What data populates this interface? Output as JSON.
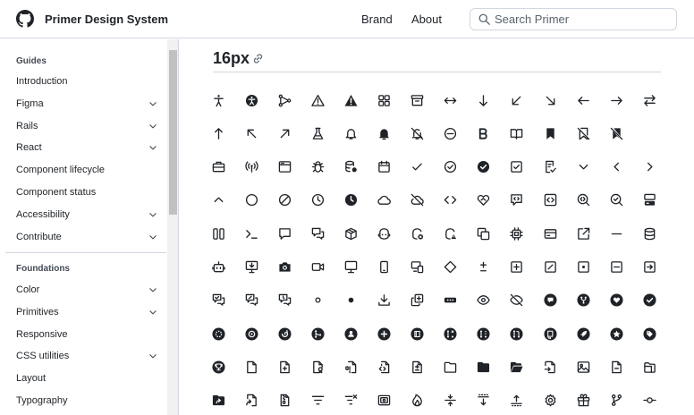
{
  "header": {
    "title": "Primer Design System",
    "nav": {
      "brand": "Brand",
      "about": "About"
    },
    "search_placeholder": "Search Primer"
  },
  "sidebar": {
    "guides_heading": "Guides",
    "guides": [
      {
        "label": "Introduction",
        "expandable": false
      },
      {
        "label": "Figma",
        "expandable": true
      },
      {
        "label": "Rails",
        "expandable": true
      },
      {
        "label": "React",
        "expandable": true
      },
      {
        "label": "Component lifecycle",
        "expandable": false
      },
      {
        "label": "Component status",
        "expandable": false
      },
      {
        "label": "Accessibility",
        "expandable": true
      },
      {
        "label": "Contribute",
        "expandable": true
      }
    ],
    "foundations_heading": "Foundations",
    "foundations": [
      {
        "label": "Color",
        "expandable": true
      },
      {
        "label": "Primitives",
        "expandable": true
      },
      {
        "label": "Responsive",
        "expandable": false
      },
      {
        "label": "CSS utilities",
        "expandable": true
      },
      {
        "label": "Layout",
        "expandable": false
      },
      {
        "label": "Typography",
        "expandable": false
      }
    ]
  },
  "main": {
    "section_title": "16px",
    "icon_rows": [
      [
        "accessibility",
        "accessibility-inset",
        "ai-model",
        "alert",
        "alert-fill",
        "apps",
        "archive",
        "arrow-both",
        "arrow-down",
        "arrow-down-left",
        "arrow-down-right",
        "arrow-left",
        "arrow-right",
        "arrow-switch"
      ],
      [
        "arrow-up",
        "arrow-up-left",
        "arrow-up-right",
        "beaker",
        "bell",
        "bell-fill",
        "bell-slash",
        "blocked",
        "bold",
        "book",
        "bookmark-fill",
        "bookmark-slash",
        "bookmark-slash-fill"
      ],
      [
        "briefcase",
        "broadcast",
        "browser",
        "bug",
        "cache",
        "calendar",
        "check",
        "check-circle",
        "check-circle-fill",
        "checkbox",
        "checklist",
        "chevron-down",
        "chevron-left",
        "chevron-right"
      ],
      [
        "chevron-up",
        "circle",
        "circle-slash",
        "clock",
        "clock-fill",
        "cloud",
        "cloud-offline",
        "code",
        "code-of-conduct",
        "code-review",
        "code-square",
        "codescan",
        "codescan-checkmark",
        "codespaces"
      ],
      [
        "columns",
        "command-palette",
        "comment",
        "comment-discussion",
        "container",
        "copilot",
        "copilot-error",
        "copilot-warning",
        "copy",
        "cpu",
        "credit-card",
        "cross-reference",
        "dash",
        "database"
      ],
      [
        "dependabot",
        "desktop-download",
        "device-camera",
        "device-camera-video",
        "device-desktop",
        "device-mobile",
        "devices",
        "diamond",
        "diff",
        "diff-added",
        "diff-ignored",
        "diff-modified",
        "diff-removed",
        "diff-renamed"
      ],
      [
        "discussion-closed",
        "discussion-duplicate",
        "discussion-outdated",
        "dot",
        "dot-fill",
        "download",
        "duplicate",
        "ellipsis",
        "eye",
        "eye-closed",
        "feed-discussion",
        "feed-forked",
        "feed-heart",
        "feed-issue-closed"
      ],
      [
        "feed-issue-draft",
        "feed-issue-open",
        "feed-issue-reopen",
        "feed-merged",
        "feed-person",
        "feed-plus",
        "feed-public",
        "feed-pull-request-closed",
        "feed-pull-request-draft",
        "feed-pull-request-open",
        "feed-repo",
        "feed-rocket",
        "feed-star",
        "feed-tag"
      ],
      [
        "feed-trophy",
        "file",
        "file-added",
        "file-badge",
        "file-binary",
        "file-code",
        "file-diff",
        "file-directory",
        "file-directory-fill",
        "file-directory-open-fill",
        "file-moved",
        "file-media",
        "file-removed",
        "file-submodule"
      ],
      [
        "file-directory-symlink",
        "file-symlink",
        "file-zip",
        "filter",
        "filter-remove",
        "fiscal-host",
        "flame",
        "fold",
        "fold-down",
        "fold-up",
        "gear",
        "gift",
        "git-branch",
        "git-commit"
      ]
    ]
  }
}
